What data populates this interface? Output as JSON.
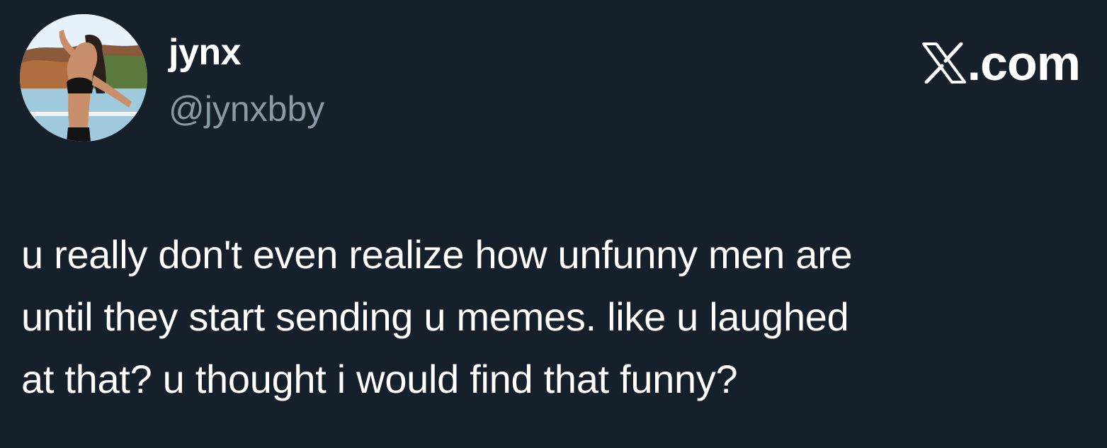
{
  "author": {
    "display_name": "jynx",
    "handle": "@jynxbby",
    "avatar_icon": "profile-photo"
  },
  "brand": {
    "logo_icon": "x-logo-icon",
    "text": ".com"
  },
  "tweet": {
    "text": "u really don't even realize how unfunny men are\nuntil they start sending u memes. like u laughed\nat that? u thought i would find that funny?"
  },
  "colors": {
    "background": "#15202b",
    "primary_text": "#ffffff",
    "secondary_text": "#8b98a5"
  }
}
